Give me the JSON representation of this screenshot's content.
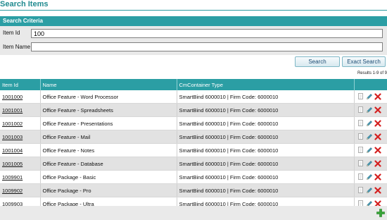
{
  "page": {
    "title": "Search Items"
  },
  "criteria": {
    "header": "Search Criteria",
    "item_id_label": "Item Id",
    "item_id_value": "100",
    "item_name_label": "Item Name",
    "item_name_value": ""
  },
  "buttons": {
    "search": "Search",
    "exact_search": "Exact Search"
  },
  "results": {
    "count_text": "Results 1-9 of 9",
    "columns": [
      "Item Id",
      "Name",
      "CmContainer Type",
      ""
    ],
    "rows": [
      {
        "id": "1001000",
        "name": "Office Feature - Word Processor",
        "container": "SmartBind 6000010 | Firm Code: 6000010"
      },
      {
        "id": "1001001",
        "name": "Office Feature - Spreadsheets",
        "container": "SmartBind 6000010 | Firm Code: 6000010"
      },
      {
        "id": "1001002",
        "name": "Office Feature - Presentations",
        "container": "SmartBind 6000010 | Firm Code: 6000010"
      },
      {
        "id": "1001003",
        "name": "Office Feature - Mail",
        "container": "SmartBind 6000010 | Firm Code: 6000010"
      },
      {
        "id": "1001004",
        "name": "Office Feature - Notes",
        "container": "SmartBind 6000010 | Firm Code: 6000010"
      },
      {
        "id": "1001005",
        "name": "Office Feature - Database",
        "container": "SmartBind 6000010 | Firm Code: 6000010"
      },
      {
        "id": "1009901",
        "name": "Office Package - Basic",
        "container": "SmartBind 6000010 | Firm Code: 6000010"
      },
      {
        "id": "1009902",
        "name": "Office Package - Pro",
        "container": "SmartBind 6000010 | Firm Code: 6000010"
      },
      {
        "id": "1009903",
        "name": "Office Package - Ultra",
        "container": "SmartBind 6000010 | Firm Code: 6000010"
      }
    ],
    "row_actions": [
      "copy-icon",
      "edit-pencil-icon",
      "delete-x-icon"
    ]
  },
  "footer": {
    "add_icon": "add-plus-icon"
  },
  "colors": {
    "accent": "#2b9ea4",
    "title": "#1f8a8f",
    "delete": "#d42020",
    "add": "#3aa63a",
    "row_alt": "#e2e2e2"
  }
}
